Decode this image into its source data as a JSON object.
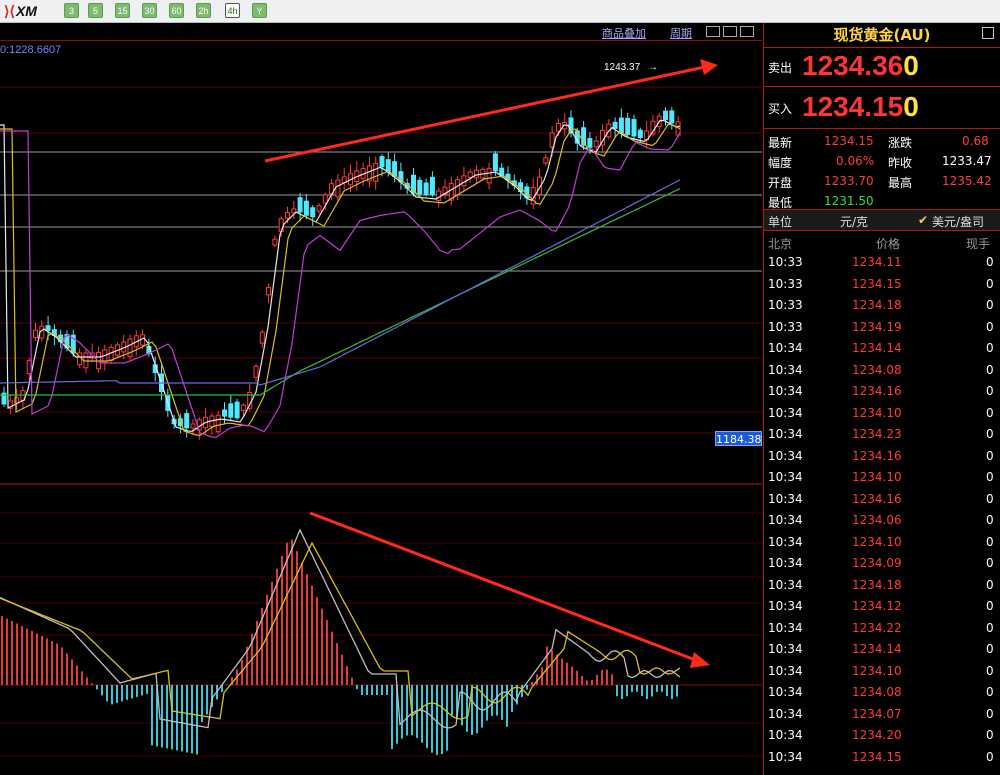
{
  "toolbar": {
    "logo": "XM",
    "timeframes": [
      "3",
      "5",
      "15",
      "30",
      "60",
      "2h",
      "4h",
      "Y"
    ],
    "selected_timeframe": "4h"
  },
  "chart": {
    "topbar_links": [
      "商品叠加",
      "周期"
    ],
    "ma_label": "0:1228.6607",
    "high_marker": "1243.37",
    "price_tag": "1184.38"
  },
  "panel": {
    "title": "现货黄金(AU)",
    "sell_label": "卖出",
    "sell_price": "1234.36",
    "sell_digit": "0",
    "buy_label": "买入",
    "buy_price": "1234.15",
    "buy_digit": "0",
    "stats": [
      {
        "label": "最新",
        "value": "1234.15",
        "color": "#ff3b3b"
      },
      {
        "label": "涨跌",
        "value": "0.68",
        "color": "#ff3b3b"
      },
      {
        "label": "幅度",
        "value": "0.06%",
        "color": "#ff3b3b"
      },
      {
        "label": "昨收",
        "value": "1233.47",
        "color": "#ffffff"
      },
      {
        "label": "开盘",
        "value": "1233.70",
        "color": "#ff3b3b"
      },
      {
        "label": "最高",
        "value": "1235.42",
        "color": "#ff3b3b"
      },
      {
        "label": "最低",
        "value": "1231.50",
        "color": "#2ee62e"
      }
    ],
    "unit_label": "单位",
    "unit_value": "元/克",
    "unit_check": "美元/盎司",
    "table_headers": [
      "北京",
      "价格",
      "现手"
    ],
    "ticks": [
      {
        "time": "10:33",
        "price": "1234.11",
        "vol": "0"
      },
      {
        "time": "10:33",
        "price": "1234.15",
        "vol": "0"
      },
      {
        "time": "10:33",
        "price": "1234.18",
        "vol": "0"
      },
      {
        "time": "10:33",
        "price": "1234.19",
        "vol": "0"
      },
      {
        "time": "10:34",
        "price": "1234.14",
        "vol": "0"
      },
      {
        "time": "10:34",
        "price": "1234.08",
        "vol": "0"
      },
      {
        "time": "10:34",
        "price": "1234.16",
        "vol": "0"
      },
      {
        "time": "10:34",
        "price": "1234.10",
        "vol": "0"
      },
      {
        "time": "10:34",
        "price": "1234.23",
        "vol": "0"
      },
      {
        "time": "10:34",
        "price": "1234.16",
        "vol": "0"
      },
      {
        "time": "10:34",
        "price": "1234.10",
        "vol": "0"
      },
      {
        "time": "10:34",
        "price": "1234.16",
        "vol": "0"
      },
      {
        "time": "10:34",
        "price": "1234.06",
        "vol": "0"
      },
      {
        "time": "10:34",
        "price": "1234.10",
        "vol": "0"
      },
      {
        "time": "10:34",
        "price": "1234.09",
        "vol": "0"
      },
      {
        "time": "10:34",
        "price": "1234.18",
        "vol": "0"
      },
      {
        "time": "10:34",
        "price": "1234.12",
        "vol": "0"
      },
      {
        "time": "10:34",
        "price": "1234.22",
        "vol": "0"
      },
      {
        "time": "10:34",
        "price": "1234.14",
        "vol": "0"
      },
      {
        "time": "10:34",
        "price": "1234.10",
        "vol": "0"
      },
      {
        "time": "10:34",
        "price": "1234.08",
        "vol": "0"
      },
      {
        "time": "10:34",
        "price": "1234.07",
        "vol": "0"
      },
      {
        "time": "10:34",
        "price": "1234.20",
        "vol": "0"
      },
      {
        "time": "10:34",
        "price": "1234.15",
        "vol": "0"
      }
    ]
  }
}
